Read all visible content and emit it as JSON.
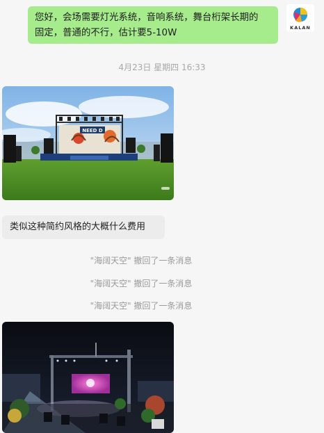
{
  "chat": {
    "outgoing_message": {
      "lines": [
        "您好，会场需要灯光系统，音响系统，舞台桁架长期的",
        "固定，普通的不行，估计要5-10W"
      ]
    },
    "avatar": {
      "logo_text": "KALAN"
    },
    "timestamp": "4月23日 星期四 16:33",
    "incoming_text": "类似这种简约风格的大概什么费用",
    "recall_notices": [
      "\"海阔天空\" 撤回了一条消息",
      "\"海阔天空\" 撤回了一条消息",
      "\"海阔天空\" 撤回了一条消息"
    ],
    "images": {
      "first_stage_banner": "NEED D"
    }
  },
  "colors": {
    "outgoing_bubble": "#a6ec8c",
    "incoming_bubble": "#ececec",
    "background": "#f6f6f7"
  }
}
